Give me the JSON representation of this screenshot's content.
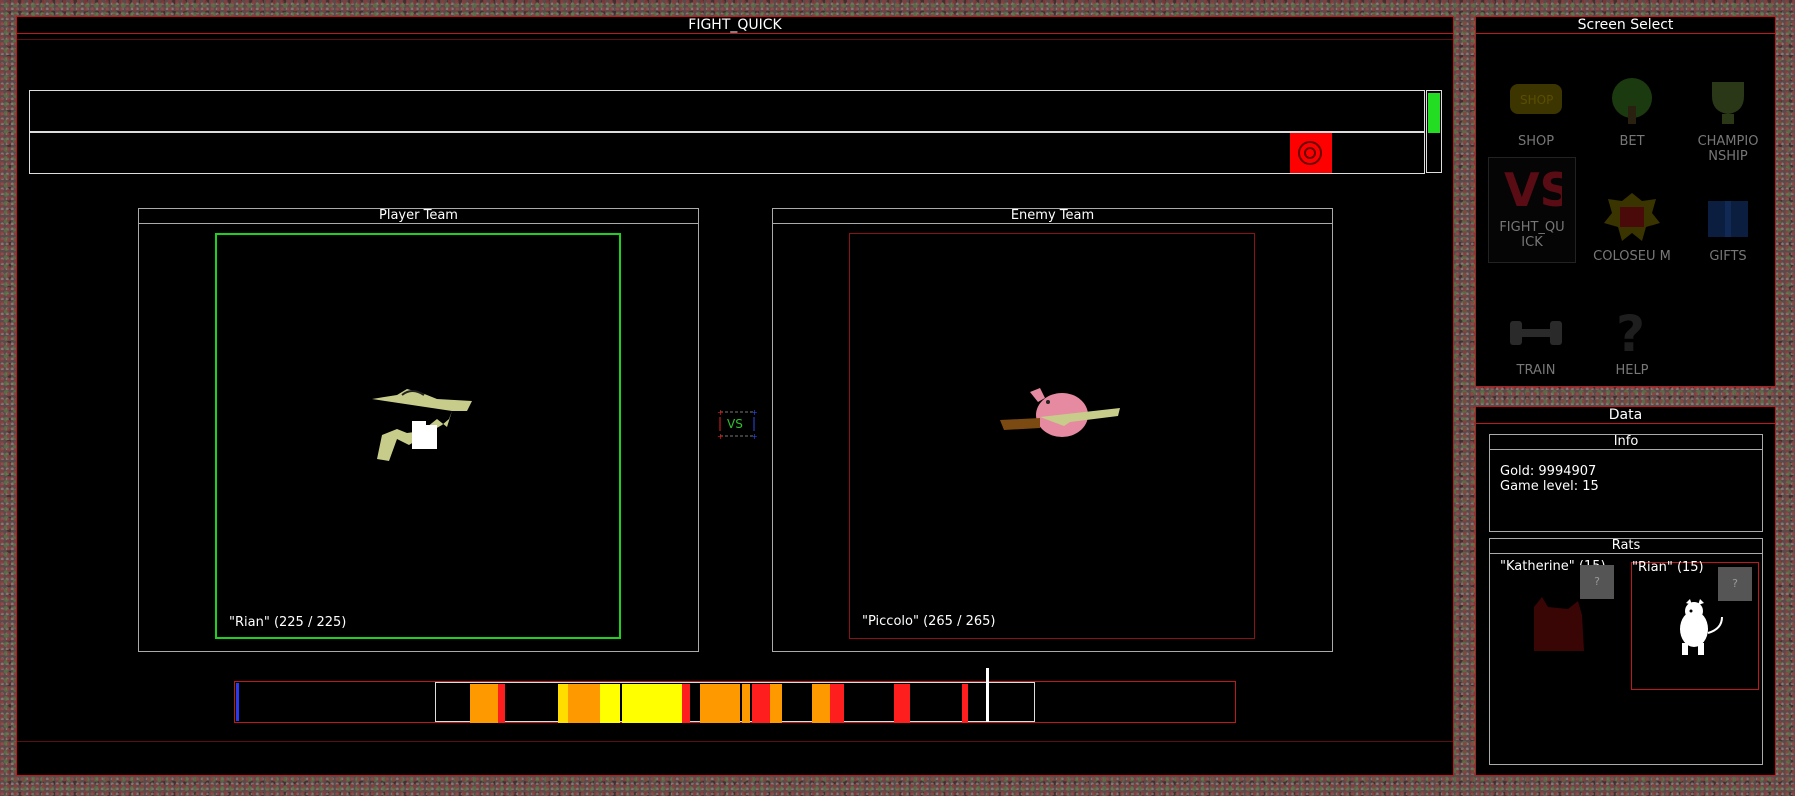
{
  "main_title": "FIGHT_QUICK",
  "player_team": {
    "title": "Player Team",
    "fighter_label": "\"Rian\" (225 / 225)"
  },
  "enemy_team": {
    "title": "Enemy Team",
    "fighter_label": "\"Piccolo\" (265 / 265)"
  },
  "vs_label": "VS",
  "screen_select": {
    "title": "Screen Select",
    "items": [
      {
        "label": "SHOP",
        "icon": "shop-sign-icon"
      },
      {
        "label": "BET",
        "icon": "money-tree-icon"
      },
      {
        "label": "CHAMPIO NSHIP",
        "icon": "trophy-icon"
      },
      {
        "label": "FIGHT_QU ICK",
        "icon": "vs-icon"
      },
      {
        "label": "COLOSEU M",
        "icon": "colosseum-icon"
      },
      {
        "label": "GIFTS",
        "icon": "gift-icon"
      },
      {
        "label": "TRAIN",
        "icon": "dumbbell-icon"
      },
      {
        "label": "HELP",
        "icon": "question-mark-icon"
      }
    ]
  },
  "data_panel": {
    "title": "Data",
    "info": {
      "title": "Info",
      "gold": "Gold: 9994907",
      "level": "Game level: 15"
    },
    "rats": {
      "title": "Rats",
      "items": [
        {
          "label": "\"Katherine\" (15)",
          "help": "?"
        },
        {
          "label": "\"Rian\" (15)",
          "help": "?"
        }
      ]
    }
  },
  "colors": {
    "border": "#c01818",
    "player_frame": "#1fd01f",
    "enemy_frame": "#8a1212",
    "timer_fill": "#22dd22",
    "enemy_marker": "#ff0000"
  }
}
